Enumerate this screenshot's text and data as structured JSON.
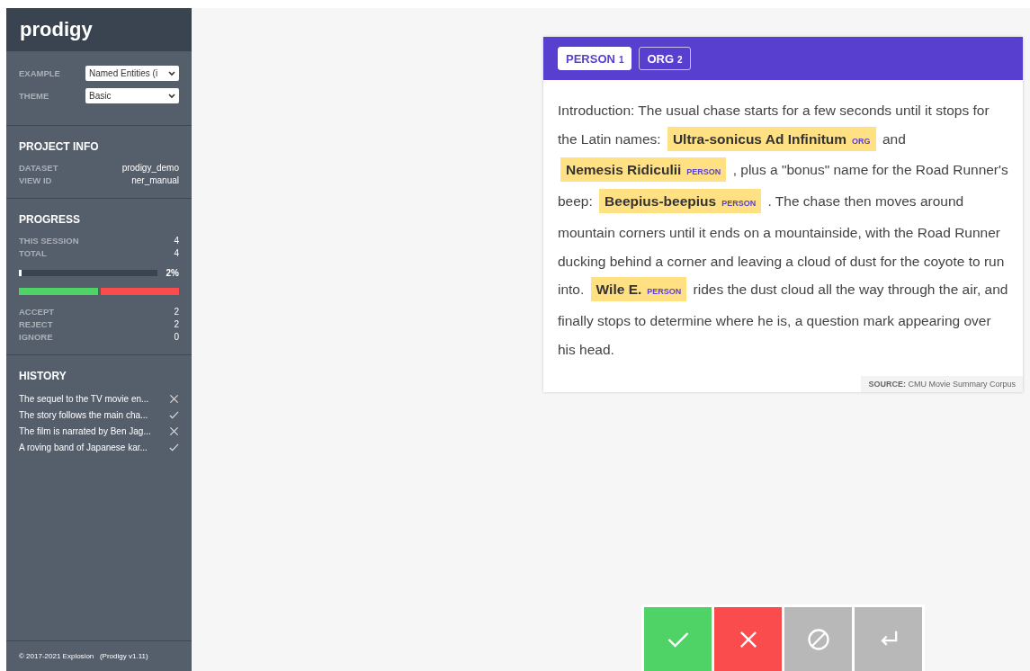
{
  "sidebar": {
    "logo": "prodigy",
    "settings": [
      {
        "label": "EXAMPLE",
        "value": "Named Entities (i"
      },
      {
        "label": "THEME",
        "value": "Basic"
      }
    ],
    "project_info": {
      "title": "PROJECT INFO",
      "rows": [
        {
          "label": "DATASET",
          "value": "prodigy_demo"
        },
        {
          "label": "VIEW ID",
          "value": "ner_manual"
        }
      ]
    },
    "progress": {
      "title": "PROGRESS",
      "rows": [
        {
          "label": "THIS SESSION",
          "value": "4"
        },
        {
          "label": "TOTAL",
          "value": "4"
        }
      ],
      "level": 0.02,
      "percent": "2%",
      "counts": [
        {
          "label": "ACCEPT",
          "value": "2"
        },
        {
          "label": "REJECT",
          "value": "2"
        },
        {
          "label": "IGNORE",
          "value": "0"
        }
      ]
    },
    "history": {
      "title": "HISTORY",
      "items": [
        {
          "text": "The sequel to the TV movie en...",
          "kind": "reject"
        },
        {
          "text": "The story follows the main cha...",
          "kind": "accept"
        },
        {
          "text": "The film is narrated by Ben Jag...",
          "kind": "reject"
        },
        {
          "text": "A roving band of Japanese kar...",
          "kind": "accept"
        }
      ]
    },
    "footer": "© 2017-2021 Explosion   (Prodigy v1.11)"
  },
  "card": {
    "labels": [
      {
        "name": "PERSON",
        "key": "1",
        "selected": true
      },
      {
        "name": "ORG",
        "key": "2",
        "selected": false
      }
    ],
    "segments": [
      {
        "kind": "text",
        "text": "Introduction: The usual chase starts for a few seconds until it stops for the Latin names: "
      },
      {
        "kind": "entity",
        "text": "Ultra-sonicus Ad Infinitum",
        "label": "ORG"
      },
      {
        "kind": "text",
        "text": " and "
      },
      {
        "kind": "entity",
        "text": "Nemesis Ridiculii",
        "label": "PERSON"
      },
      {
        "kind": "text",
        "text": " , plus a \"bonus\" name for the Road Runner's beep: "
      },
      {
        "kind": "entity",
        "text": "Beepius-beepius",
        "label": "PERSON"
      },
      {
        "kind": "text",
        "text": " . The chase then moves around mountain corners until it ends on a mountainside, with the Road Runner ducking behind a corner and leaving a cloud of dust for the coyote to run into. "
      },
      {
        "kind": "entity",
        "text": "Wile E.",
        "label": "PERSON"
      },
      {
        "kind": "text",
        "text": " rides the dust cloud all the way through the air, and finally stops to determine where he is, a question mark appearing over his head."
      }
    ],
    "source_label": "SOURCE:",
    "source": "CMU Movie Summary Corpus"
  },
  "actions": [
    {
      "kind": "accept"
    },
    {
      "kind": "reject"
    },
    {
      "kind": "ignore"
    },
    {
      "kind": "undo"
    }
  ]
}
